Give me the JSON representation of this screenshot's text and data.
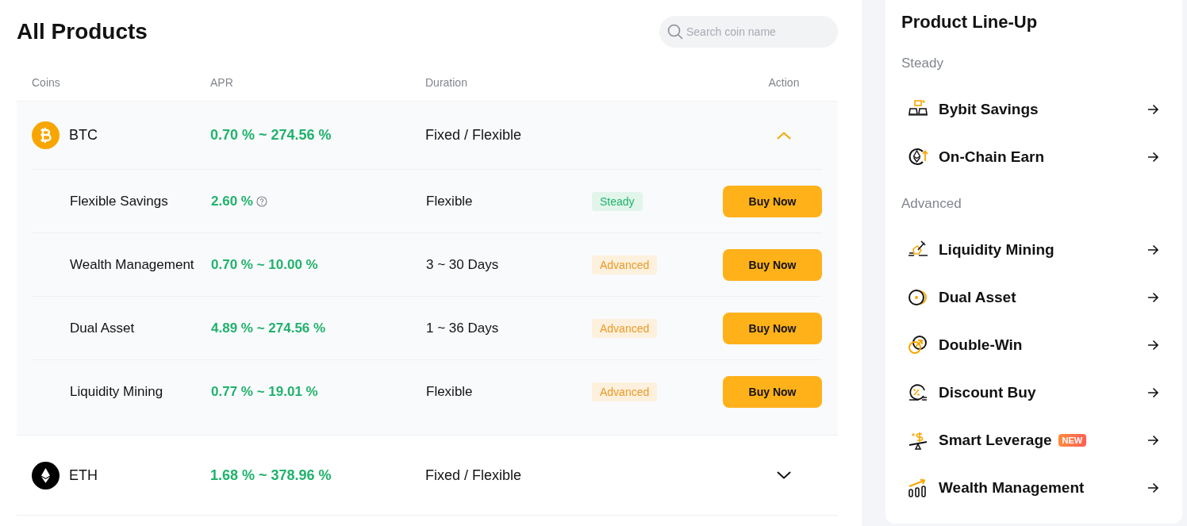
{
  "products": {
    "title": "All Products",
    "search": {
      "placeholder": "Search coin name"
    },
    "columns": [
      "Coins",
      "APR",
      "Duration",
      "Action"
    ],
    "coins": [
      {
        "name": "BTC",
        "apr": "0.70 % ~ 274.56 %",
        "duration": "Fixed / Flexible",
        "expanded": true,
        "products": [
          {
            "name": "Flexible Savings",
            "apr": "2.60 %",
            "has_info": true,
            "duration": "Flexible",
            "tag": {
              "label": "Steady",
              "kind": "steady"
            },
            "button": "Buy Now"
          },
          {
            "name": "Wealth Management",
            "apr": "0.70 % ~ 10.00 %",
            "has_info": false,
            "duration": "3 ~ 30 Days",
            "tag": {
              "label": "Advanced",
              "kind": "advanced"
            },
            "button": "Buy Now"
          },
          {
            "name": "Dual Asset",
            "apr": "4.89 % ~ 274.56 %",
            "has_info": false,
            "duration": "1 ~ 36 Days",
            "tag": {
              "label": "Advanced",
              "kind": "advanced"
            },
            "button": "Buy Now"
          },
          {
            "name": "Liquidity Mining",
            "apr": "0.77 % ~ 19.01 %",
            "has_info": false,
            "duration": "Flexible",
            "tag": {
              "label": "Advanced",
              "kind": "advanced"
            },
            "button": "Buy Now"
          }
        ]
      },
      {
        "name": "ETH",
        "apr": "1.68 % ~ 378.96 %",
        "duration": "Fixed / Flexible",
        "expanded": false
      }
    ]
  },
  "lineup": {
    "title": "Product Line-Up",
    "sections": [
      {
        "heading": "Steady",
        "items": [
          {
            "label": "Bybit Savings"
          },
          {
            "label": "On-Chain Earn"
          }
        ]
      },
      {
        "heading": "Advanced",
        "items": [
          {
            "label": "Liquidity Mining"
          },
          {
            "label": "Dual Asset"
          },
          {
            "label": "Double-Win"
          },
          {
            "label": "Discount Buy"
          },
          {
            "label": "Smart Leverage",
            "badge": "NEW"
          },
          {
            "label": "Wealth Management"
          }
        ]
      }
    ]
  }
}
